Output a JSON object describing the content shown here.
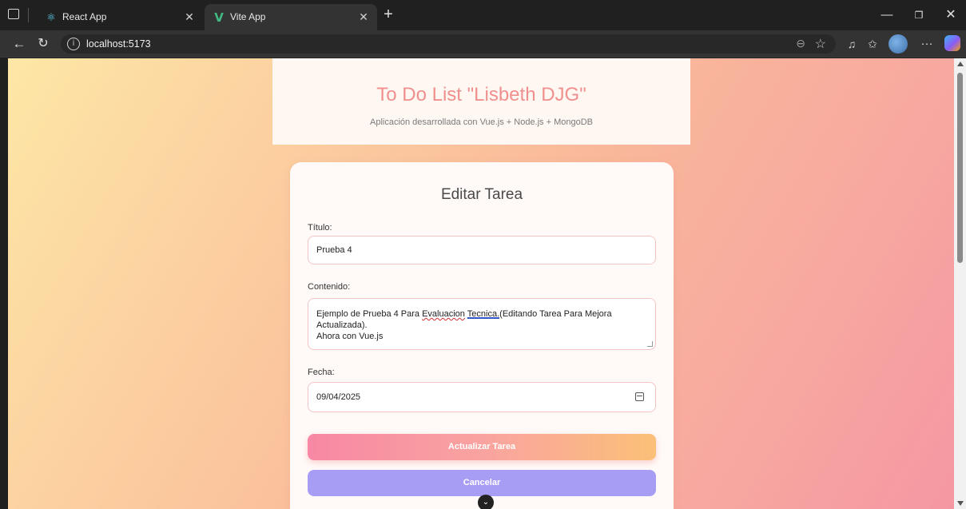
{
  "browser": {
    "tabs": [
      {
        "title": "React App",
        "favicon": "react-icon",
        "active": false
      },
      {
        "title": "Vite App",
        "favicon": "vue-icon",
        "active": true
      }
    ],
    "url": "localhost:5173"
  },
  "header": {
    "title": "To Do List \"Lisbeth DJG\"",
    "subtitle": "Aplicación desarrollada con Vue.js + Node.js + MongoDB"
  },
  "form": {
    "heading": "Editar Tarea",
    "title_label": "Título:",
    "title_value": "Prueba 4",
    "content_label": "Contenido:",
    "content_value": {
      "part1": "Ejemplo de Prueba 4 Para ",
      "spell1": "Evaluacion",
      "part2": " ",
      "grammar1": "Tecnica.(",
      "part3": "Editando Tarea Para Mejora Actualizada).",
      "line2": "Ahora con Vue.js"
    },
    "date_label": "Fecha:",
    "date_value": "09/04/2025",
    "update_button": "Actualizar Tarea",
    "cancel_button": "Cancelar"
  },
  "colors": {
    "title_pink": "#f0908e",
    "cancel_purple": "#a79df4",
    "field_border": "#f4c4c4"
  }
}
